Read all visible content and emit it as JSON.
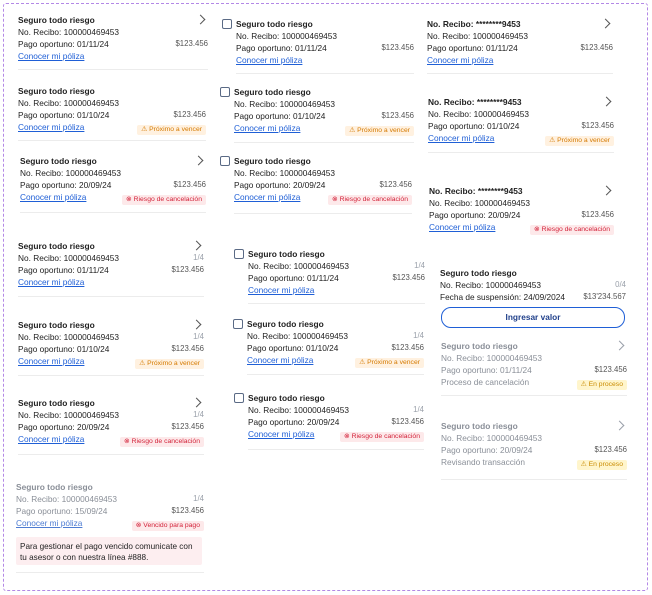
{
  "common": {
    "title": "Seguro todo riesgo",
    "recibo": "No. Recibo: 100000469453",
    "recibo_masked": "No. Recibo: ********9453",
    "amount": "$123.456",
    "link": "Conocer mi póliza"
  },
  "dates": {
    "d1": "Pago oportuno: 01/11/24",
    "d2": "Pago oportuno: 01/10/24",
    "d3": "Pago oportuno: 20/09/24",
    "d4": "Pago oportuno: 15/09/24"
  },
  "badges": {
    "proximo": "⚠ Próximo a vencer",
    "riesgo": "⊗ Riesgo de cancelación",
    "vencido": "⊗ Vencido para pago",
    "en_proceso": "⚠ En proceso"
  },
  "fractions": {
    "f14": "1/4",
    "f04": "0/4"
  },
  "vencido_note": "Para gestionar el pago vencido comunicate con tu asesor o con nuestra línea #888.",
  "suspension": {
    "fecha": "Fecha de suspensión: 24/09/2024",
    "amount": "$13'234.567",
    "button": "Ingresar valor"
  },
  "proceso": {
    "cancelacion": "Proceso de cancelación",
    "transaccion": "Revisando transacción"
  }
}
